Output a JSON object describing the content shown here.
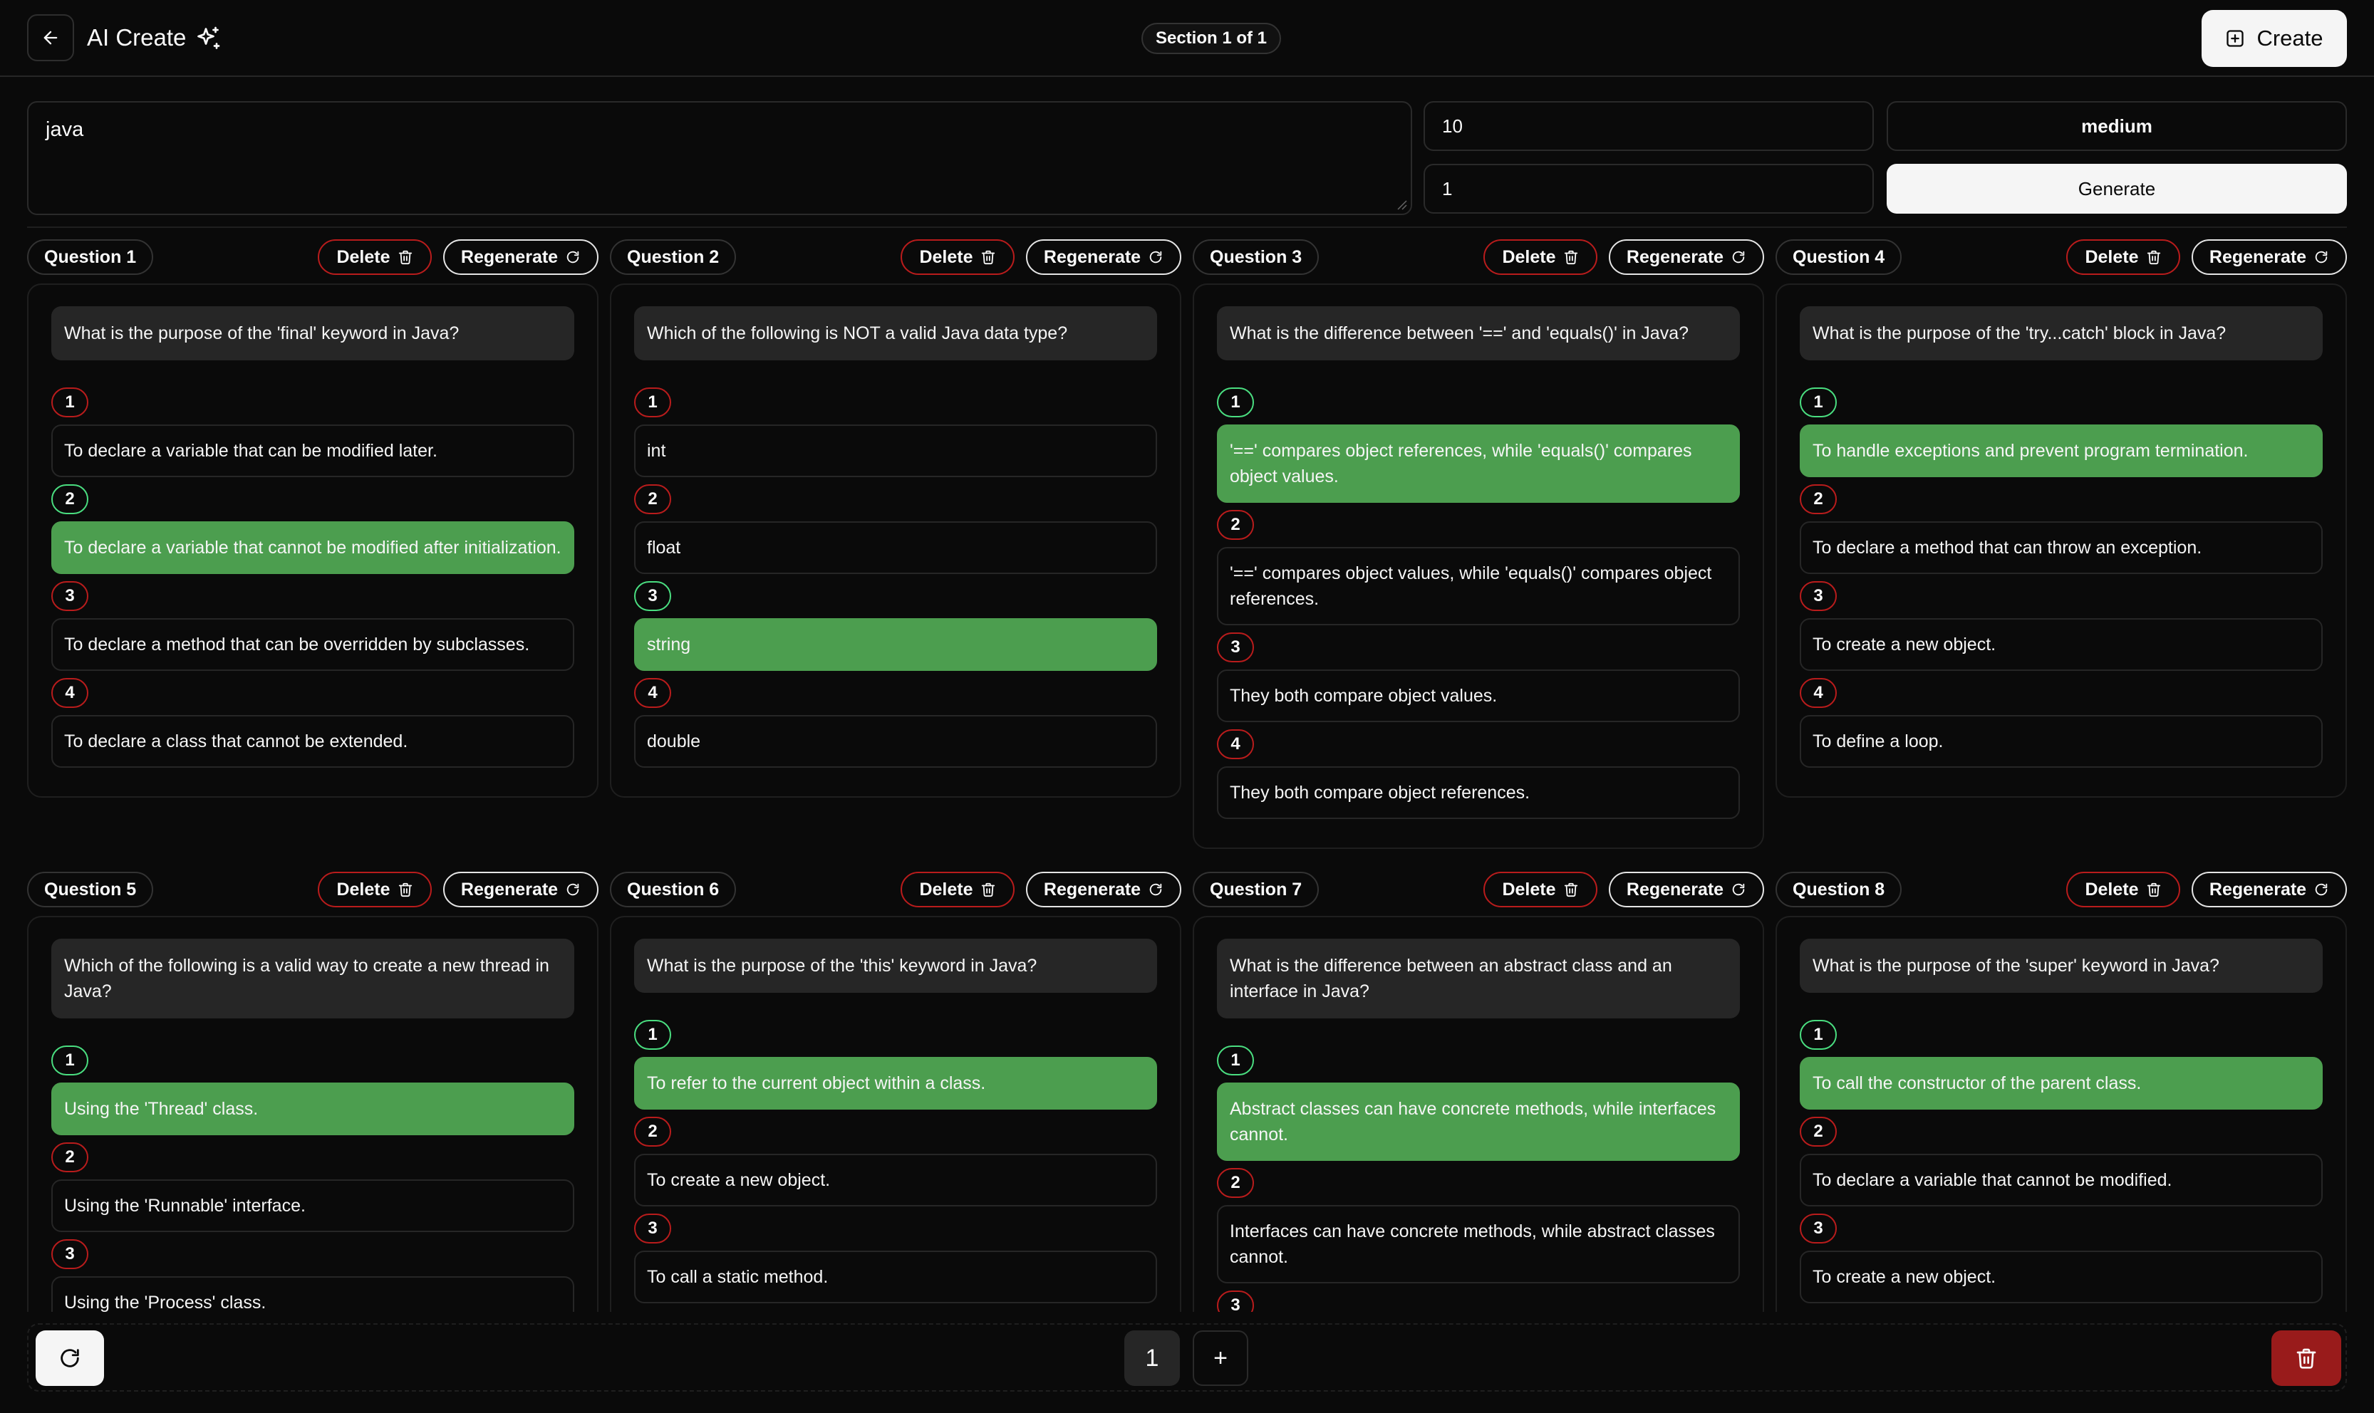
{
  "header": {
    "title": "AI Create",
    "section_indicator": "Section 1 of 1",
    "create_label": "Create"
  },
  "controls": {
    "topic": "java",
    "question_count": "10",
    "sections": "1",
    "difficulty": "medium",
    "generate_label": "Generate"
  },
  "card_actions": {
    "delete_label": "Delete",
    "regenerate_label": "Regenerate"
  },
  "questions": [
    {
      "label": "Question 1",
      "text": "What is the purpose of the 'final' keyword in Java?",
      "options": [
        {
          "num": "1",
          "text": "To declare a variable that can be modified later.",
          "correct": false
        },
        {
          "num": "2",
          "text": "To declare a variable that cannot be modified after initialization.",
          "correct": true
        },
        {
          "num": "3",
          "text": "To declare a method that can be overridden by subclasses.",
          "correct": false
        },
        {
          "num": "4",
          "text": "To declare a class that cannot be extended.",
          "correct": false
        }
      ]
    },
    {
      "label": "Question 2",
      "text": "Which of the following is NOT a valid Java data type?",
      "options": [
        {
          "num": "1",
          "text": "int",
          "correct": false
        },
        {
          "num": "2",
          "text": "float",
          "correct": false
        },
        {
          "num": "3",
          "text": "string",
          "correct": true
        },
        {
          "num": "4",
          "text": "double",
          "correct": false
        }
      ]
    },
    {
      "label": "Question 3",
      "text": "What is the difference between '==' and 'equals()' in Java?",
      "options": [
        {
          "num": "1",
          "text": "'==' compares object references, while 'equals()' compares object values.",
          "correct": true
        },
        {
          "num": "2",
          "text": "'==' compares object values, while 'equals()' compares object references.",
          "correct": false
        },
        {
          "num": "3",
          "text": "They both compare object values.",
          "correct": false
        },
        {
          "num": "4",
          "text": "They both compare object references.",
          "correct": false
        }
      ]
    },
    {
      "label": "Question 4",
      "text": "What is the purpose of the 'try...catch' block in Java?",
      "options": [
        {
          "num": "1",
          "text": "To handle exceptions and prevent program termination.",
          "correct": true
        },
        {
          "num": "2",
          "text": "To declare a method that can throw an exception.",
          "correct": false
        },
        {
          "num": "3",
          "text": "To create a new object.",
          "correct": false
        },
        {
          "num": "4",
          "text": "To define a loop.",
          "correct": false
        }
      ]
    },
    {
      "label": "Question 5",
      "text": "Which of the following is a valid way to create a new thread in Java?",
      "options": [
        {
          "num": "1",
          "text": "Using the 'Thread' class.",
          "correct": true
        },
        {
          "num": "2",
          "text": "Using the 'Runnable' interface.",
          "correct": false
        },
        {
          "num": "3",
          "text": "Using the 'Process' class.",
          "correct": false
        }
      ]
    },
    {
      "label": "Question 6",
      "text": "What is the purpose of the 'this' keyword in Java?",
      "options": [
        {
          "num": "1",
          "text": "To refer to the current object within a class.",
          "correct": true
        },
        {
          "num": "2",
          "text": "To create a new object.",
          "correct": false
        },
        {
          "num": "3",
          "text": "To call a static method.",
          "correct": false
        }
      ]
    },
    {
      "label": "Question 7",
      "text": "What is the difference between an abstract class and an interface in Java?",
      "options": [
        {
          "num": "1",
          "text": "Abstract classes can have concrete methods, while interfaces cannot.",
          "correct": true
        },
        {
          "num": "2",
          "text": "Interfaces can have concrete methods, while abstract classes cannot.",
          "correct": false
        },
        {
          "num": "3",
          "text": "",
          "correct": false
        }
      ]
    },
    {
      "label": "Question 8",
      "text": "What is the purpose of the 'super' keyword in Java?",
      "options": [
        {
          "num": "1",
          "text": "To call the constructor of the parent class.",
          "correct": true
        },
        {
          "num": "2",
          "text": "To declare a variable that cannot be modified.",
          "correct": false
        },
        {
          "num": "3",
          "text": "To create a new object.",
          "correct": false
        }
      ]
    }
  ],
  "footer": {
    "current_page": "1",
    "add_page_label": "+"
  },
  "colors": {
    "background": "#0a0a0a",
    "correct": "#4c9e4f",
    "danger": "#b91c1c",
    "question_bg": "#262626"
  }
}
